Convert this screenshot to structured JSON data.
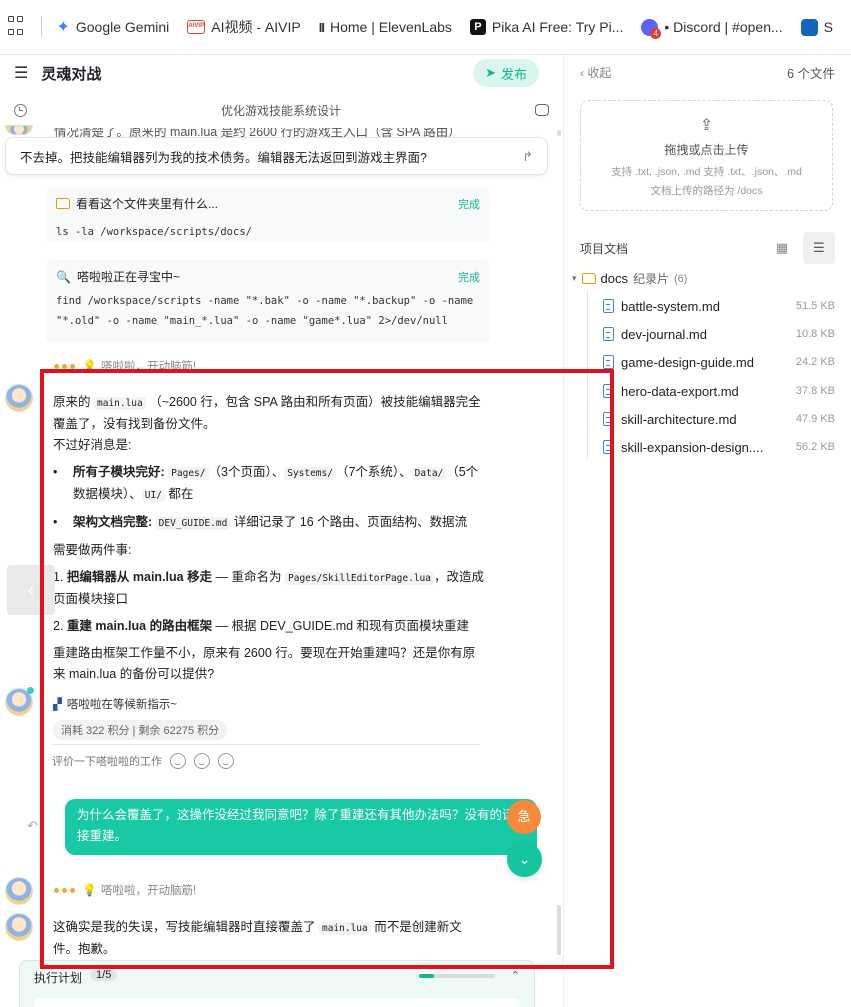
{
  "bookmarks": [
    {
      "label": "Google Gemini",
      "icon": "gemini-icon"
    },
    {
      "label": "AI视频 - AIVIP",
      "icon": "aivip-icon"
    },
    {
      "label": "Home | ElevenLabs",
      "icon": "elevenlabs-icon"
    },
    {
      "label": "Pika AI Free: Try Pi...",
      "icon": "pika-icon"
    },
    {
      "label": "• Discord | #open...",
      "icon": "discord-icon"
    },
    {
      "label": "S",
      "icon": "panda-icon"
    }
  ],
  "header": {
    "title": "灵魂对战",
    "publish_label": "发布"
  },
  "subheader": {
    "conversation_title": "优化游戏技能系统设计"
  },
  "chat": {
    "scroll_text": "情况清楚了。原来的 main.lua 是约 2600 行的游戏主入口（含 SPA 路由）",
    "hint_text": "不去掉。把技能编辑器列为我的技术债务。编辑器无法返回到游戏主界面?",
    "tool1": {
      "title": "看看这个文件夹里有什么...",
      "status": "完成",
      "command": "ls -la /workspace/scripts/docs/"
    },
    "tool2": {
      "title": "嗒啦啦正在寻宝中~",
      "status": "完成",
      "command_line1": "find /workspace/scripts -name \"*.bak\" -o -name \"*.backup\" -o -name",
      "command_line2": "\"*.old\" -o -name \"main_*.lua\" -o -name \"game*.lua\" 2>/dev/null"
    },
    "thinking_text": "嗒啦啦，开动脑筋!",
    "answer": {
      "p1_a": "原来的 ",
      "p1_code": "main.lua",
      "p1_b": "（~2600 行，包含 SPA 路由和所有页面）被技能编辑器完全覆盖了，没有找到备份文件。",
      "p2": "不过好消息是:",
      "b1_bold": "所有子模块完好",
      "b1_colon": ":",
      "b1_code1": "Pages/",
      "b1_t1": "（3个页面）、",
      "b1_code2": "Systems/",
      "b1_t2": "（7个系统）、",
      "b1_code3": "Data/",
      "b1_t3": "（5个数据模块）、",
      "b1_code4": "UI/",
      "b1_t4": "都在",
      "b2_bold": "架构文档完整",
      "b2_colon": ":",
      "b2_code": "DEV_GUIDE.md",
      "b2_t": "详细记录了 16 个路由、页面结构、数据流",
      "p3": "需要做两件事:",
      "n1_num": "1.",
      "n1_bold": "把编辑器从 main.lua 移走",
      "n1_t": " — 重命名为 ",
      "n1_code": "Pages/SkillEditorPage.lua",
      "n1_t2": "，改造成页面模块接口",
      "n2_num": "2.",
      "n2_bold": "重建 main.lua 的路由框架",
      "n2_t": " — 根据 DEV_GUIDE.md 和现有页面模块重建",
      "p4": "重建路由框架工作量不小，原来有 2600 行。要现在开始重建吗？还是你有原来 main.lua 的备份可以提供?"
    },
    "waiting_text": "嗒啦啦在等候新指示~",
    "cost_text": "消耗 322 积分 | 剩余 62275 积分",
    "rate_text": "评价一下嗒啦啦的工作",
    "user_message": "为什么会覆盖了，这操作没经过我同意吧？除了重建还有其他办法吗？没有的话接重建。",
    "fab_label": "急",
    "thinking_text2": "嗒啦啦，开动脑筋!",
    "final_a": "这确实是我的失误，写技能编辑器时直接覆盖了 ",
    "final_code": "main.lua",
    "final_b": " 而不是创建新文件。抱歉。"
  },
  "plan": {
    "label": "执行计划",
    "count": "1/5",
    "progress": 0.2
  },
  "files": {
    "collapse_label": "收起",
    "file_count": "6 个文件",
    "upload_title": "拖拽或点击上传",
    "upload_types": "支持 .txt, .json, .md  支持 .txt、.json、.md",
    "upload_path": "文档上传的路径为 /docs",
    "project_docs_label": "项目文档",
    "folder_name": "docs",
    "folder_sub": "纪录片",
    "folder_count": "(6)",
    "items": [
      {
        "name": "battle-system.md",
        "size": "51.5 KB"
      },
      {
        "name": "dev-journal.md",
        "size": "10.8 KB"
      },
      {
        "name": "game-design-guide.md",
        "size": "24.2 KB"
      },
      {
        "name": "hero-data-export.md",
        "size": "37.8 KB"
      },
      {
        "name": "skill-architecture.md",
        "size": "47.9 KB"
      },
      {
        "name": "skill-expansion-design....",
        "size": "56.2 KB"
      }
    ]
  },
  "colors": {
    "accent": "#13b68f",
    "highlight_box": "#e0121e",
    "user_bubble": "#18c9a5"
  }
}
